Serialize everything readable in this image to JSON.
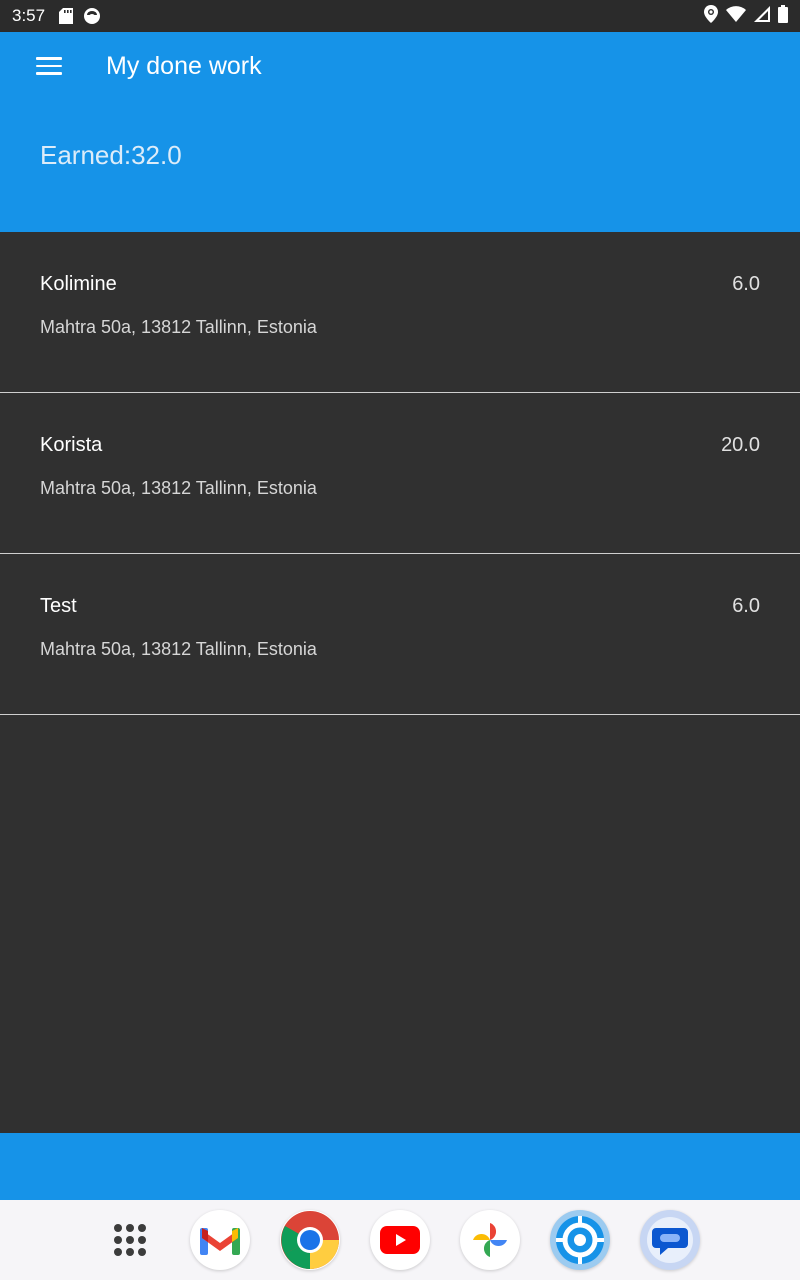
{
  "status_bar": {
    "time": "3:57",
    "left_icons": [
      "sd-card-icon",
      "notification-icon"
    ],
    "right_icons": [
      "location-icon",
      "wifi-icon",
      "signal-icon",
      "battery-icon"
    ]
  },
  "app_bar": {
    "menu_icon": "menu-icon",
    "title": "My done work",
    "color": "#1693e8"
  },
  "summary": {
    "earned": "Earned:32.0"
  },
  "jobs": [
    {
      "name": "Kolimine",
      "amount": "6.0",
      "address": "Mahtra 50a, 13812 Tallinn, Estonia"
    },
    {
      "name": "Korista",
      "amount": "20.0",
      "address": "Mahtra 50a, 13812 Tallinn, Estonia"
    },
    {
      "name": "Test",
      "amount": "6.0",
      "address": "Mahtra 50a, 13812 Tallinn, Estonia"
    }
  ],
  "dock": {
    "apps": [
      "app-drawer-icon",
      "gmail-icon",
      "chrome-icon",
      "youtube-icon",
      "photos-icon",
      "target-app-icon",
      "messages-icon"
    ]
  }
}
